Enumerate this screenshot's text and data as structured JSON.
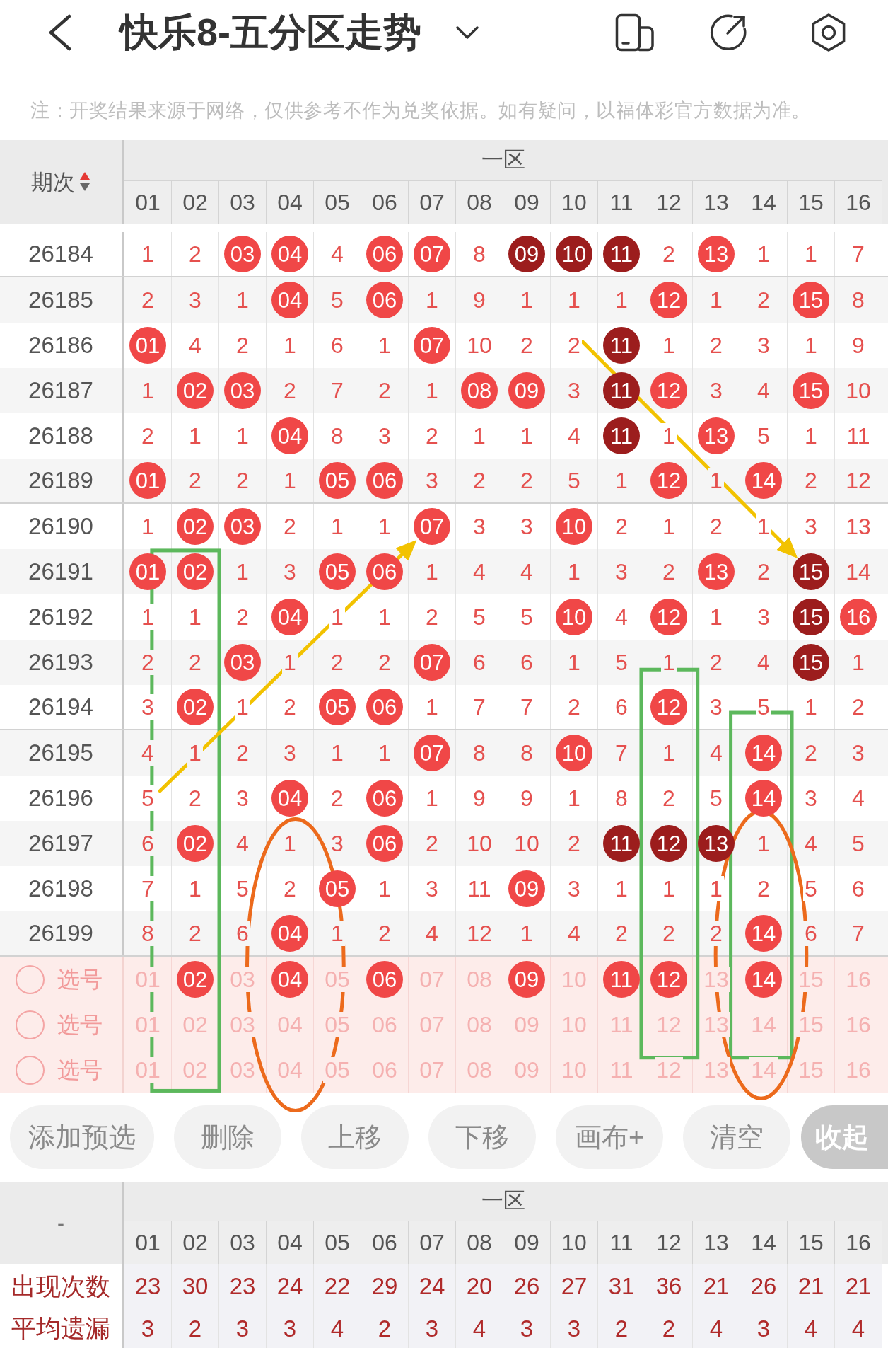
{
  "header": {
    "title": "快乐8-五分区走势"
  },
  "disclaimer": "注：开奖结果来源于网络，仅供参考不作为兑奖依据。如有疑问，以福体彩官方数据为准。",
  "trend": {
    "period_heading": "期次",
    "sort_ascending": true,
    "zone": "一区",
    "columns": [
      "01",
      "02",
      "03",
      "04",
      "05",
      "06",
      "07",
      "08",
      "09",
      "10",
      "11",
      "12",
      "13",
      "14",
      "15",
      "16"
    ],
    "rows": [
      {
        "period": "26184",
        "cells": [
          {
            "text": "1",
            "kind": "count"
          },
          {
            "text": "2",
            "kind": "count"
          },
          {
            "text": "03",
            "kind": "ball"
          },
          {
            "text": "04",
            "kind": "ball"
          },
          {
            "text": "4",
            "kind": "count"
          },
          {
            "text": "06",
            "kind": "ball"
          },
          {
            "text": "07",
            "kind": "ball"
          },
          {
            "text": "8",
            "kind": "count"
          },
          {
            "text": "09",
            "kind": "darkball"
          },
          {
            "text": "10",
            "kind": "darkball"
          },
          {
            "text": "11",
            "kind": "darkball"
          },
          {
            "text": "2",
            "kind": "count"
          },
          {
            "text": "13",
            "kind": "ball"
          },
          {
            "text": "1",
            "kind": "count"
          },
          {
            "text": "1",
            "kind": "count"
          },
          {
            "text": "7",
            "kind": "count"
          }
        ]
      },
      {
        "period": "26185",
        "cells": [
          {
            "text": "2",
            "kind": "count"
          },
          {
            "text": "3",
            "kind": "count"
          },
          {
            "text": "1",
            "kind": "count"
          },
          {
            "text": "04",
            "kind": "ball"
          },
          {
            "text": "5",
            "kind": "count"
          },
          {
            "text": "06",
            "kind": "ball"
          },
          {
            "text": "1",
            "kind": "count"
          },
          {
            "text": "9",
            "kind": "count"
          },
          {
            "text": "1",
            "kind": "count"
          },
          {
            "text": "1",
            "kind": "count"
          },
          {
            "text": "1",
            "kind": "count"
          },
          {
            "text": "12",
            "kind": "ball"
          },
          {
            "text": "1",
            "kind": "count"
          },
          {
            "text": "2",
            "kind": "count"
          },
          {
            "text": "15",
            "kind": "ball"
          },
          {
            "text": "8",
            "kind": "count"
          }
        ]
      },
      {
        "period": "26186",
        "cells": [
          {
            "text": "01",
            "kind": "ball"
          },
          {
            "text": "4",
            "kind": "count"
          },
          {
            "text": "2",
            "kind": "count"
          },
          {
            "text": "1",
            "kind": "count"
          },
          {
            "text": "6",
            "kind": "count"
          },
          {
            "text": "1",
            "kind": "count"
          },
          {
            "text": "07",
            "kind": "ball"
          },
          {
            "text": "10",
            "kind": "count"
          },
          {
            "text": "2",
            "kind": "count"
          },
          {
            "text": "2",
            "kind": "count"
          },
          {
            "text": "11",
            "kind": "darkball"
          },
          {
            "text": "1",
            "kind": "count"
          },
          {
            "text": "2",
            "kind": "count"
          },
          {
            "text": "3",
            "kind": "count"
          },
          {
            "text": "1",
            "kind": "count"
          },
          {
            "text": "9",
            "kind": "count"
          }
        ]
      },
      {
        "period": "26187",
        "cells": [
          {
            "text": "1",
            "kind": "count"
          },
          {
            "text": "02",
            "kind": "ball"
          },
          {
            "text": "03",
            "kind": "ball"
          },
          {
            "text": "2",
            "kind": "count"
          },
          {
            "text": "7",
            "kind": "count"
          },
          {
            "text": "2",
            "kind": "count"
          },
          {
            "text": "1",
            "kind": "count"
          },
          {
            "text": "08",
            "kind": "ball"
          },
          {
            "text": "09",
            "kind": "ball"
          },
          {
            "text": "3",
            "kind": "count"
          },
          {
            "text": "11",
            "kind": "darkball"
          },
          {
            "text": "12",
            "kind": "ball"
          },
          {
            "text": "3",
            "kind": "count"
          },
          {
            "text": "4",
            "kind": "count"
          },
          {
            "text": "15",
            "kind": "ball"
          },
          {
            "text": "10",
            "kind": "count"
          }
        ]
      },
      {
        "period": "26188",
        "cells": [
          {
            "text": "2",
            "kind": "count"
          },
          {
            "text": "1",
            "kind": "count"
          },
          {
            "text": "1",
            "kind": "count"
          },
          {
            "text": "04",
            "kind": "ball"
          },
          {
            "text": "8",
            "kind": "count"
          },
          {
            "text": "3",
            "kind": "count"
          },
          {
            "text": "2",
            "kind": "count"
          },
          {
            "text": "1",
            "kind": "count"
          },
          {
            "text": "1",
            "kind": "count"
          },
          {
            "text": "4",
            "kind": "count"
          },
          {
            "text": "11",
            "kind": "darkball"
          },
          {
            "text": "1",
            "kind": "count"
          },
          {
            "text": "13",
            "kind": "ball"
          },
          {
            "text": "5",
            "kind": "count"
          },
          {
            "text": "1",
            "kind": "count"
          },
          {
            "text": "11",
            "kind": "count"
          }
        ]
      },
      {
        "period": "26189",
        "cells": [
          {
            "text": "01",
            "kind": "ball"
          },
          {
            "text": "2",
            "kind": "count"
          },
          {
            "text": "2",
            "kind": "count"
          },
          {
            "text": "1",
            "kind": "count"
          },
          {
            "text": "05",
            "kind": "ball"
          },
          {
            "text": "06",
            "kind": "ball"
          },
          {
            "text": "3",
            "kind": "count"
          },
          {
            "text": "2",
            "kind": "count"
          },
          {
            "text": "2",
            "kind": "count"
          },
          {
            "text": "5",
            "kind": "count"
          },
          {
            "text": "1",
            "kind": "count"
          },
          {
            "text": "12",
            "kind": "ball"
          },
          {
            "text": "1",
            "kind": "count"
          },
          {
            "text": "14",
            "kind": "ball"
          },
          {
            "text": "2",
            "kind": "count"
          },
          {
            "text": "12",
            "kind": "count"
          }
        ]
      },
      {
        "period": "26190",
        "cells": [
          {
            "text": "1",
            "kind": "count"
          },
          {
            "text": "02",
            "kind": "ball"
          },
          {
            "text": "03",
            "kind": "ball"
          },
          {
            "text": "2",
            "kind": "count"
          },
          {
            "text": "1",
            "kind": "count"
          },
          {
            "text": "1",
            "kind": "count"
          },
          {
            "text": "07",
            "kind": "ball"
          },
          {
            "text": "3",
            "kind": "count"
          },
          {
            "text": "3",
            "kind": "count"
          },
          {
            "text": "10",
            "kind": "ball"
          },
          {
            "text": "2",
            "kind": "count"
          },
          {
            "text": "1",
            "kind": "count"
          },
          {
            "text": "2",
            "kind": "count"
          },
          {
            "text": "1",
            "kind": "count"
          },
          {
            "text": "3",
            "kind": "count"
          },
          {
            "text": "13",
            "kind": "count"
          }
        ]
      },
      {
        "period": "26191",
        "cells": [
          {
            "text": "01",
            "kind": "ball"
          },
          {
            "text": "02",
            "kind": "ball"
          },
          {
            "text": "1",
            "kind": "count"
          },
          {
            "text": "3",
            "kind": "count"
          },
          {
            "text": "05",
            "kind": "ball"
          },
          {
            "text": "06",
            "kind": "ball"
          },
          {
            "text": "1",
            "kind": "count"
          },
          {
            "text": "4",
            "kind": "count"
          },
          {
            "text": "4",
            "kind": "count"
          },
          {
            "text": "1",
            "kind": "count"
          },
          {
            "text": "3",
            "kind": "count"
          },
          {
            "text": "2",
            "kind": "count"
          },
          {
            "text": "13",
            "kind": "ball"
          },
          {
            "text": "2",
            "kind": "count"
          },
          {
            "text": "15",
            "kind": "darkball"
          },
          {
            "text": "14",
            "kind": "count"
          }
        ]
      },
      {
        "period": "26192",
        "cells": [
          {
            "text": "1",
            "kind": "count"
          },
          {
            "text": "1",
            "kind": "count"
          },
          {
            "text": "2",
            "kind": "count"
          },
          {
            "text": "04",
            "kind": "ball"
          },
          {
            "text": "1",
            "kind": "count"
          },
          {
            "text": "1",
            "kind": "count"
          },
          {
            "text": "2",
            "kind": "count"
          },
          {
            "text": "5",
            "kind": "count"
          },
          {
            "text": "5",
            "kind": "count"
          },
          {
            "text": "10",
            "kind": "ball"
          },
          {
            "text": "4",
            "kind": "count"
          },
          {
            "text": "12",
            "kind": "ball"
          },
          {
            "text": "1",
            "kind": "count"
          },
          {
            "text": "3",
            "kind": "count"
          },
          {
            "text": "15",
            "kind": "darkball"
          },
          {
            "text": "16",
            "kind": "ball"
          }
        ]
      },
      {
        "period": "26193",
        "cells": [
          {
            "text": "2",
            "kind": "count"
          },
          {
            "text": "2",
            "kind": "count"
          },
          {
            "text": "03",
            "kind": "ball"
          },
          {
            "text": "1",
            "kind": "count"
          },
          {
            "text": "2",
            "kind": "count"
          },
          {
            "text": "2",
            "kind": "count"
          },
          {
            "text": "07",
            "kind": "ball"
          },
          {
            "text": "6",
            "kind": "count"
          },
          {
            "text": "6",
            "kind": "count"
          },
          {
            "text": "1",
            "kind": "count"
          },
          {
            "text": "5",
            "kind": "count"
          },
          {
            "text": "1",
            "kind": "count"
          },
          {
            "text": "2",
            "kind": "count"
          },
          {
            "text": "4",
            "kind": "count"
          },
          {
            "text": "15",
            "kind": "darkball"
          },
          {
            "text": "1",
            "kind": "count"
          }
        ]
      },
      {
        "period": "26194",
        "cells": [
          {
            "text": "3",
            "kind": "count"
          },
          {
            "text": "02",
            "kind": "ball"
          },
          {
            "text": "1",
            "kind": "count"
          },
          {
            "text": "2",
            "kind": "count"
          },
          {
            "text": "05",
            "kind": "ball"
          },
          {
            "text": "06",
            "kind": "ball"
          },
          {
            "text": "1",
            "kind": "count"
          },
          {
            "text": "7",
            "kind": "count"
          },
          {
            "text": "7",
            "kind": "count"
          },
          {
            "text": "2",
            "kind": "count"
          },
          {
            "text": "6",
            "kind": "count"
          },
          {
            "text": "12",
            "kind": "ball"
          },
          {
            "text": "3",
            "kind": "count"
          },
          {
            "text": "5",
            "kind": "count"
          },
          {
            "text": "1",
            "kind": "count"
          },
          {
            "text": "2",
            "kind": "count"
          }
        ]
      },
      {
        "period": "26195",
        "cells": [
          {
            "text": "4",
            "kind": "count"
          },
          {
            "text": "1",
            "kind": "count"
          },
          {
            "text": "2",
            "kind": "count"
          },
          {
            "text": "3",
            "kind": "count"
          },
          {
            "text": "1",
            "kind": "count"
          },
          {
            "text": "1",
            "kind": "count"
          },
          {
            "text": "07",
            "kind": "ball"
          },
          {
            "text": "8",
            "kind": "count"
          },
          {
            "text": "8",
            "kind": "count"
          },
          {
            "text": "10",
            "kind": "ball"
          },
          {
            "text": "7",
            "kind": "count"
          },
          {
            "text": "1",
            "kind": "count"
          },
          {
            "text": "4",
            "kind": "count"
          },
          {
            "text": "14",
            "kind": "ball"
          },
          {
            "text": "2",
            "kind": "count"
          },
          {
            "text": "3",
            "kind": "count"
          }
        ]
      },
      {
        "period": "26196",
        "cells": [
          {
            "text": "5",
            "kind": "count"
          },
          {
            "text": "2",
            "kind": "count"
          },
          {
            "text": "3",
            "kind": "count"
          },
          {
            "text": "04",
            "kind": "ball"
          },
          {
            "text": "2",
            "kind": "count"
          },
          {
            "text": "06",
            "kind": "ball"
          },
          {
            "text": "1",
            "kind": "count"
          },
          {
            "text": "9",
            "kind": "count"
          },
          {
            "text": "9",
            "kind": "count"
          },
          {
            "text": "1",
            "kind": "count"
          },
          {
            "text": "8",
            "kind": "count"
          },
          {
            "text": "2",
            "kind": "count"
          },
          {
            "text": "5",
            "kind": "count"
          },
          {
            "text": "14",
            "kind": "ball"
          },
          {
            "text": "3",
            "kind": "count"
          },
          {
            "text": "4",
            "kind": "count"
          }
        ]
      },
      {
        "period": "26197",
        "cells": [
          {
            "text": "6",
            "kind": "count"
          },
          {
            "text": "02",
            "kind": "ball"
          },
          {
            "text": "4",
            "kind": "count"
          },
          {
            "text": "1",
            "kind": "count"
          },
          {
            "text": "3",
            "kind": "count"
          },
          {
            "text": "06",
            "kind": "ball"
          },
          {
            "text": "2",
            "kind": "count"
          },
          {
            "text": "10",
            "kind": "count"
          },
          {
            "text": "10",
            "kind": "count"
          },
          {
            "text": "2",
            "kind": "count"
          },
          {
            "text": "11",
            "kind": "darkball"
          },
          {
            "text": "12",
            "kind": "darkball"
          },
          {
            "text": "13",
            "kind": "darkball"
          },
          {
            "text": "1",
            "kind": "count"
          },
          {
            "text": "4",
            "kind": "count"
          },
          {
            "text": "5",
            "kind": "count"
          }
        ]
      },
      {
        "period": "26198",
        "cells": [
          {
            "text": "7",
            "kind": "count"
          },
          {
            "text": "1",
            "kind": "count"
          },
          {
            "text": "5",
            "kind": "count"
          },
          {
            "text": "2",
            "kind": "count"
          },
          {
            "text": "05",
            "kind": "ball"
          },
          {
            "text": "1",
            "kind": "count"
          },
          {
            "text": "3",
            "kind": "count"
          },
          {
            "text": "11",
            "kind": "count"
          },
          {
            "text": "09",
            "kind": "ball"
          },
          {
            "text": "3",
            "kind": "count"
          },
          {
            "text": "1",
            "kind": "count"
          },
          {
            "text": "1",
            "kind": "count"
          },
          {
            "text": "1",
            "kind": "count"
          },
          {
            "text": "2",
            "kind": "count"
          },
          {
            "text": "5",
            "kind": "count"
          },
          {
            "text": "6",
            "kind": "count"
          }
        ]
      },
      {
        "period": "26199",
        "cells": [
          {
            "text": "8",
            "kind": "count"
          },
          {
            "text": "2",
            "kind": "count"
          },
          {
            "text": "6",
            "kind": "count"
          },
          {
            "text": "04",
            "kind": "ball"
          },
          {
            "text": "1",
            "kind": "count"
          },
          {
            "text": "2",
            "kind": "count"
          },
          {
            "text": "4",
            "kind": "count"
          },
          {
            "text": "12",
            "kind": "count"
          },
          {
            "text": "1",
            "kind": "count"
          },
          {
            "text": "4",
            "kind": "count"
          },
          {
            "text": "2",
            "kind": "count"
          },
          {
            "text": "2",
            "kind": "count"
          },
          {
            "text": "2",
            "kind": "count"
          },
          {
            "text": "14",
            "kind": "ball"
          },
          {
            "text": "6",
            "kind": "count"
          },
          {
            "text": "7",
            "kind": "count"
          }
        ]
      }
    ],
    "pick_rows": [
      {
        "checked": false,
        "label": "选号",
        "cells": [
          {
            "text": "01",
            "kind": "faint"
          },
          {
            "text": "02",
            "kind": "ball"
          },
          {
            "text": "03",
            "kind": "faint"
          },
          {
            "text": "04",
            "kind": "ball"
          },
          {
            "text": "05",
            "kind": "faint"
          },
          {
            "text": "06",
            "kind": "ball"
          },
          {
            "text": "07",
            "kind": "faint"
          },
          {
            "text": "08",
            "kind": "faint"
          },
          {
            "text": "09",
            "kind": "ball"
          },
          {
            "text": "10",
            "kind": "faint"
          },
          {
            "text": "11",
            "kind": "ball"
          },
          {
            "text": "12",
            "kind": "ball"
          },
          {
            "text": "13",
            "kind": "faint"
          },
          {
            "text": "14",
            "kind": "ball"
          },
          {
            "text": "15",
            "kind": "faint"
          },
          {
            "text": "16",
            "kind": "faint"
          }
        ]
      },
      {
        "checked": false,
        "label": "选号",
        "cells": [
          {
            "text": "01",
            "kind": "faint"
          },
          {
            "text": "02",
            "kind": "faint"
          },
          {
            "text": "03",
            "kind": "faint"
          },
          {
            "text": "04",
            "kind": "faint"
          },
          {
            "text": "05",
            "kind": "faint"
          },
          {
            "text": "06",
            "kind": "faint"
          },
          {
            "text": "07",
            "kind": "faint"
          },
          {
            "text": "08",
            "kind": "faint"
          },
          {
            "text": "09",
            "kind": "faint"
          },
          {
            "text": "10",
            "kind": "faint"
          },
          {
            "text": "11",
            "kind": "faint"
          },
          {
            "text": "12",
            "kind": "faint"
          },
          {
            "text": "13",
            "kind": "faint"
          },
          {
            "text": "14",
            "kind": "faint"
          },
          {
            "text": "15",
            "kind": "faint"
          },
          {
            "text": "16",
            "kind": "faint"
          }
        ]
      },
      {
        "checked": false,
        "label": "选号",
        "cells": [
          {
            "text": "01",
            "kind": "faint"
          },
          {
            "text": "02",
            "kind": "faint"
          },
          {
            "text": "03",
            "kind": "faint"
          },
          {
            "text": "04",
            "kind": "faint"
          },
          {
            "text": "05",
            "kind": "faint"
          },
          {
            "text": "06",
            "kind": "faint"
          },
          {
            "text": "07",
            "kind": "faint"
          },
          {
            "text": "08",
            "kind": "faint"
          },
          {
            "text": "09",
            "kind": "faint"
          },
          {
            "text": "10",
            "kind": "faint"
          },
          {
            "text": "11",
            "kind": "faint"
          },
          {
            "text": "12",
            "kind": "faint"
          },
          {
            "text": "13",
            "kind": "faint"
          },
          {
            "text": "14",
            "kind": "faint"
          },
          {
            "text": "15",
            "kind": "faint"
          },
          {
            "text": "16",
            "kind": "faint"
          }
        ]
      }
    ]
  },
  "annotations": [
    {
      "kind": "arrow",
      "color": "#f2c200"
    },
    {
      "kind": "box",
      "color": "#5cb85c"
    },
    {
      "kind": "arrow",
      "color": "#f2c200"
    },
    {
      "kind": "box",
      "color": "#5cb85c"
    },
    {
      "kind": "box",
      "color": "#5cb85c"
    },
    {
      "kind": "ellipse",
      "color": "#ec6a1c"
    },
    {
      "kind": "ellipse",
      "color": "#ec6a1c"
    }
  ],
  "buttons": [
    {
      "label": "添加预选",
      "kind": "action"
    },
    {
      "label": "删除",
      "kind": "action"
    },
    {
      "label": "上移",
      "kind": "action"
    },
    {
      "label": "下移",
      "kind": "action"
    },
    {
      "label": "画布+",
      "kind": "action"
    },
    {
      "label": "清空",
      "kind": "action"
    },
    {
      "label": "收起",
      "kind": "toggle"
    }
  ],
  "stats": {
    "corner": "-",
    "zone": "一区",
    "columns": [
      "01",
      "02",
      "03",
      "04",
      "05",
      "06",
      "07",
      "08",
      "09",
      "10",
      "11",
      "12",
      "13",
      "14",
      "15",
      "16"
    ],
    "rows": [
      {
        "label": "出现次数",
        "values": [
          "23",
          "30",
          "23",
          "24",
          "22",
          "29",
          "24",
          "20",
          "26",
          "27",
          "31",
          "36",
          "21",
          "26",
          "21",
          "21"
        ]
      },
      {
        "label": "平均遗漏",
        "values": [
          "3",
          "2",
          "3",
          "3",
          "4",
          "2",
          "3",
          "4",
          "3",
          "3",
          "2",
          "2",
          "4",
          "3",
          "4",
          "4"
        ]
      }
    ]
  }
}
